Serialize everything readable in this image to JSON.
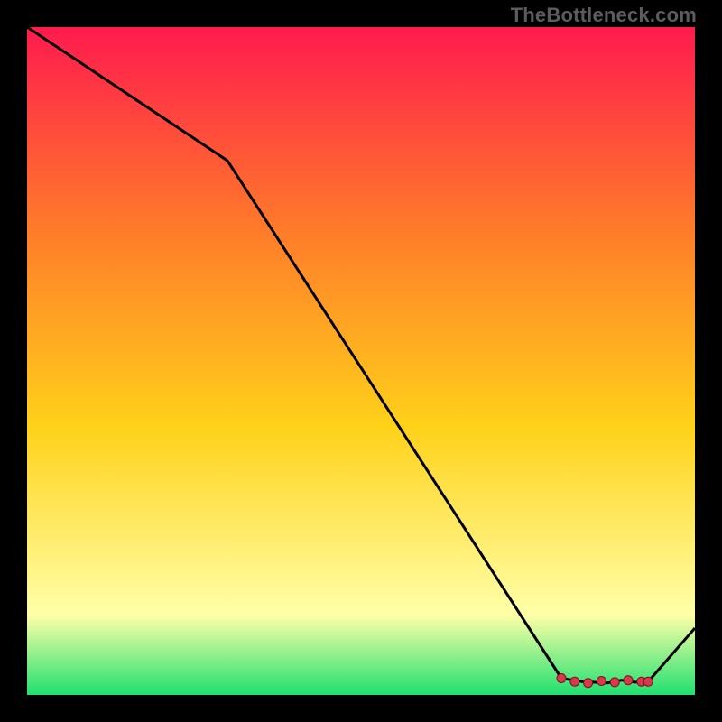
{
  "watermark": "TheBottleneck.com",
  "gradient": {
    "top": "#ff1a4e",
    "upper": "#ff7a2a",
    "mid": "#ffd21a",
    "lower": "#ffffa8",
    "bottom": "#20e070"
  },
  "chart_data": {
    "type": "line",
    "title": "",
    "xlabel": "",
    "ylabel": "",
    "xlim": [
      0,
      100
    ],
    "ylim": [
      0,
      100
    ],
    "series": [
      {
        "name": "curve",
        "x": [
          0,
          30,
          80,
          83,
          87,
          89,
          91,
          93,
          100
        ],
        "values": [
          100,
          80,
          2.5,
          2.0,
          1.8,
          2.2,
          1.9,
          2.0,
          10
        ]
      }
    ],
    "markers": {
      "name": "highlight-points",
      "x": [
        80,
        82,
        84,
        86,
        88,
        90,
        92,
        93
      ],
      "values": [
        2.5,
        2.0,
        1.8,
        2.1,
        1.9,
        2.2,
        2.0,
        2.0
      ]
    }
  }
}
